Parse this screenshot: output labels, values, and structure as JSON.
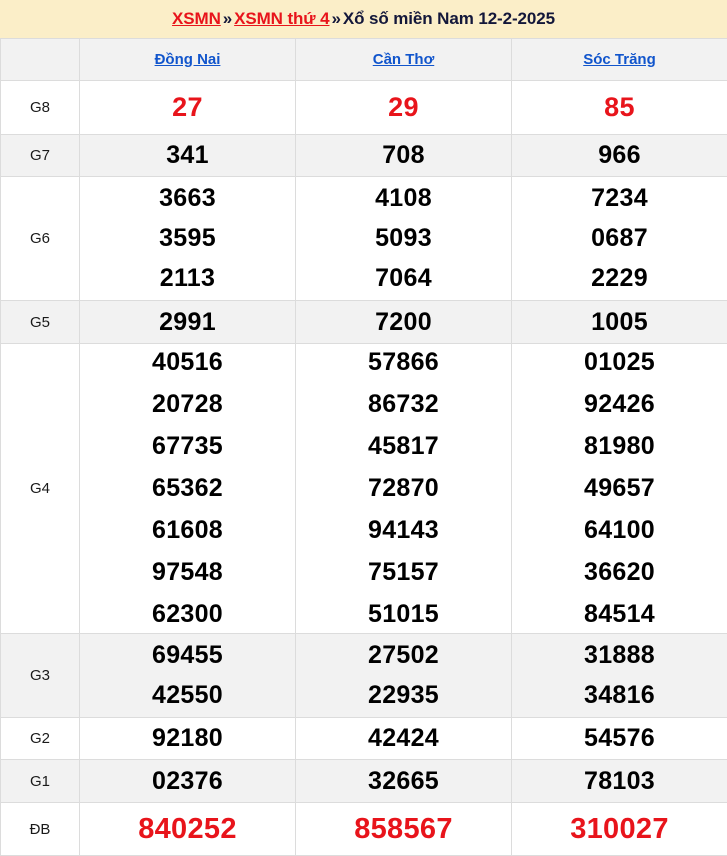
{
  "breadcrumb": {
    "link1": "XSMN",
    "sep": "»",
    "link2": "XSMN thứ 4",
    "current": "Xổ số miền Nam 12-2-2025"
  },
  "colors": {
    "banner_bg": "#fbeec8",
    "link_red": "#e8141b",
    "province_blue": "#1155cc",
    "stripe_gray": "#f2f2f2",
    "number_black": "#000000"
  },
  "table": {
    "corner_label": "",
    "provinces": [
      "Đồng Nai",
      "Cần Thơ",
      "Sóc Trăng"
    ],
    "rows": [
      {
        "prize": "G8",
        "highlight": true,
        "values": [
          [
            "27"
          ],
          [
            "29"
          ],
          [
            "85"
          ]
        ]
      },
      {
        "prize": "G7",
        "highlight": false,
        "values": [
          [
            "341"
          ],
          [
            "708"
          ],
          [
            "966"
          ]
        ]
      },
      {
        "prize": "G6",
        "highlight": false,
        "values": [
          [
            "3663",
            "3595",
            "2113"
          ],
          [
            "4108",
            "5093",
            "7064"
          ],
          [
            "7234",
            "0687",
            "2229"
          ]
        ]
      },
      {
        "prize": "G5",
        "highlight": false,
        "values": [
          [
            "2991"
          ],
          [
            "7200"
          ],
          [
            "1005"
          ]
        ]
      },
      {
        "prize": "G4",
        "highlight": false,
        "values": [
          [
            "40516",
            "20728",
            "67735",
            "65362",
            "61608",
            "97548",
            "62300"
          ],
          [
            "57866",
            "86732",
            "45817",
            "72870",
            "94143",
            "75157",
            "51015"
          ],
          [
            "01025",
            "92426",
            "81980",
            "49657",
            "64100",
            "36620",
            "84514"
          ]
        ]
      },
      {
        "prize": "G3",
        "highlight": false,
        "values": [
          [
            "69455",
            "42550"
          ],
          [
            "27502",
            "22935"
          ],
          [
            "31888",
            "34816"
          ]
        ]
      },
      {
        "prize": "G2",
        "highlight": false,
        "values": [
          [
            "92180"
          ],
          [
            "42424"
          ],
          [
            "54576"
          ]
        ]
      },
      {
        "prize": "G1",
        "highlight": false,
        "values": [
          [
            "02376"
          ],
          [
            "32665"
          ],
          [
            "78103"
          ]
        ]
      },
      {
        "prize": "ĐB",
        "highlight": true,
        "values": [
          [
            "840252"
          ],
          [
            "858567"
          ],
          [
            "310027"
          ]
        ]
      }
    ]
  }
}
